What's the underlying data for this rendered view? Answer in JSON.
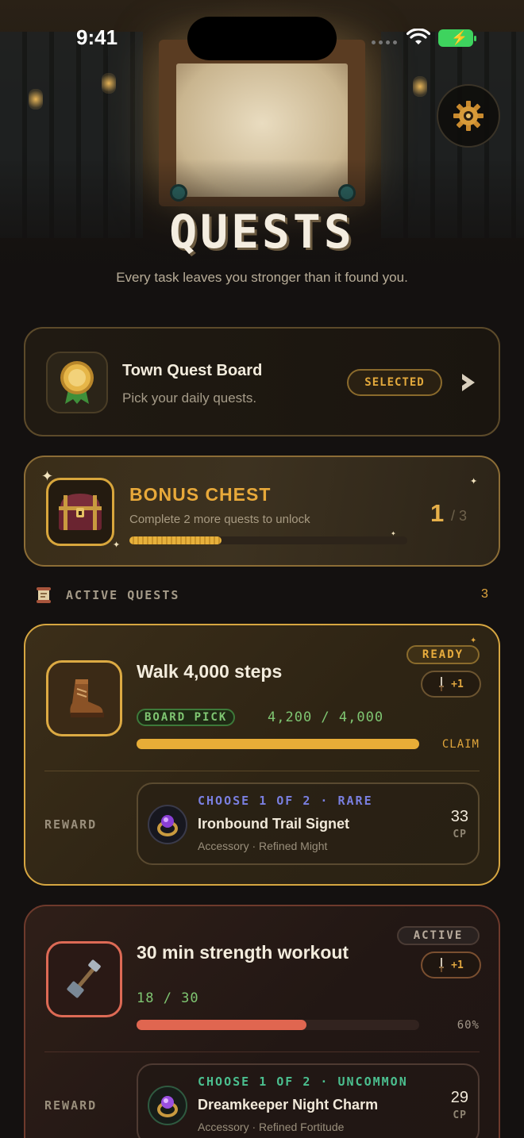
{
  "status_bar": {
    "time": "9:41"
  },
  "header": {
    "title": "QUESTS",
    "subtitle": "Every task leaves you stronger than it found you."
  },
  "board": {
    "title": "Town Quest Board",
    "subtitle": "Pick your daily quests.",
    "badge": "SELECTED"
  },
  "bonus_chest": {
    "title": "BONUS CHEST",
    "subtitle": "Complete 2 more quests to unlock",
    "completed": "1",
    "total": "/ 3",
    "progress_fraction": 0.33
  },
  "active_section": {
    "title": "ACTIVE QUESTS",
    "count": "3"
  },
  "quests": [
    {
      "title": "Walk 4,000 steps",
      "status": "READY",
      "might": "+1",
      "badge": "BOARD PICK",
      "progress_text": "4,200 / 4,000",
      "progress_fraction": 1.0,
      "progress_label": "CLAIM",
      "reward_label": "REWARD",
      "reward": {
        "choose": "CHOOSE 1 OF 2 · RARE",
        "name": "Ironbound Trail Signet",
        "meta": "Accessory · Refined Might",
        "cp_value": "33",
        "cp_unit": "CP"
      }
    },
    {
      "title": "30 min strength workout",
      "status": "ACTIVE",
      "might": "+1",
      "progress_text": "18 / 30",
      "progress_fraction": 0.6,
      "progress_label": "60%",
      "reward_label": "REWARD",
      "reward": {
        "choose": "CHOOSE 1 OF 2 · UNCOMMON",
        "name": "Dreamkeeper Night Charm",
        "meta": "Accessory · Refined Fortitude",
        "cp_value": "29",
        "cp_unit": "CP"
      }
    }
  ],
  "colors": {
    "accent_gold": "#e8ad37",
    "accent_red": "#e06650",
    "progress_green": "#7fc672",
    "rare_blue": "#7a7fe0",
    "uncommon_green": "#4bbf8f"
  },
  "icons": [
    "gear-icon",
    "medal-icon",
    "chevron-right-icon",
    "treasure-chest-icon",
    "scroll-icon",
    "boot-icon",
    "dagger-icon",
    "ring-icon",
    "hammer-icon"
  ]
}
